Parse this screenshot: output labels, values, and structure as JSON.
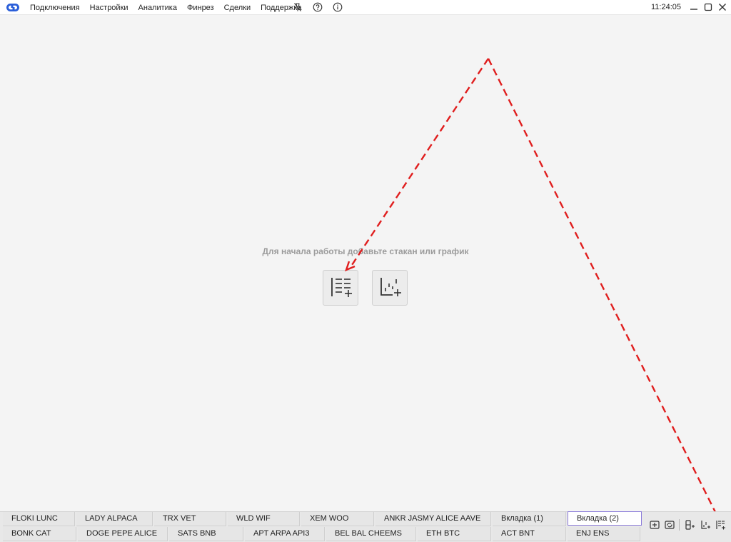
{
  "menu": [
    "Подключения",
    "Настройки",
    "Аналитика",
    "Финрез",
    "Сделки",
    "Поддержка"
  ],
  "clock": "11:24:05",
  "hint": "Для начала работы добавьте стакан или график",
  "icons": {
    "logo": "app-logo",
    "pin": "pin-off-icon",
    "help": "help-icon",
    "info": "info-icon",
    "minimize": "minimize-icon",
    "maximize": "maximize-icon",
    "close": "close-icon",
    "add_orderbook": "add-orderbook-icon",
    "add_chart": "add-chart-icon"
  },
  "tabs_row1": [
    "FLOKI LUNC",
    "LADY ALPACA",
    "TRX VET",
    "WLD WIF",
    "XEM WOO",
    "ANKR JASMY ALICE AAVE",
    "Вкладка (1)",
    "Вкладка (2)"
  ],
  "tabs_row2": [
    "BONK CAT",
    "DOGE PEPE ALICE",
    "SATS BNB",
    "APT ARPA API3",
    "BEL BAL CHEEMS",
    "ETH BTC",
    "ACT BNT",
    "ENJ ENS"
  ],
  "active_tab": "Вкладка (2)",
  "colors": {
    "accent": "#2b5fd9",
    "arrow": "#e01e1e",
    "active_tab_border": "#8b7bd9"
  }
}
